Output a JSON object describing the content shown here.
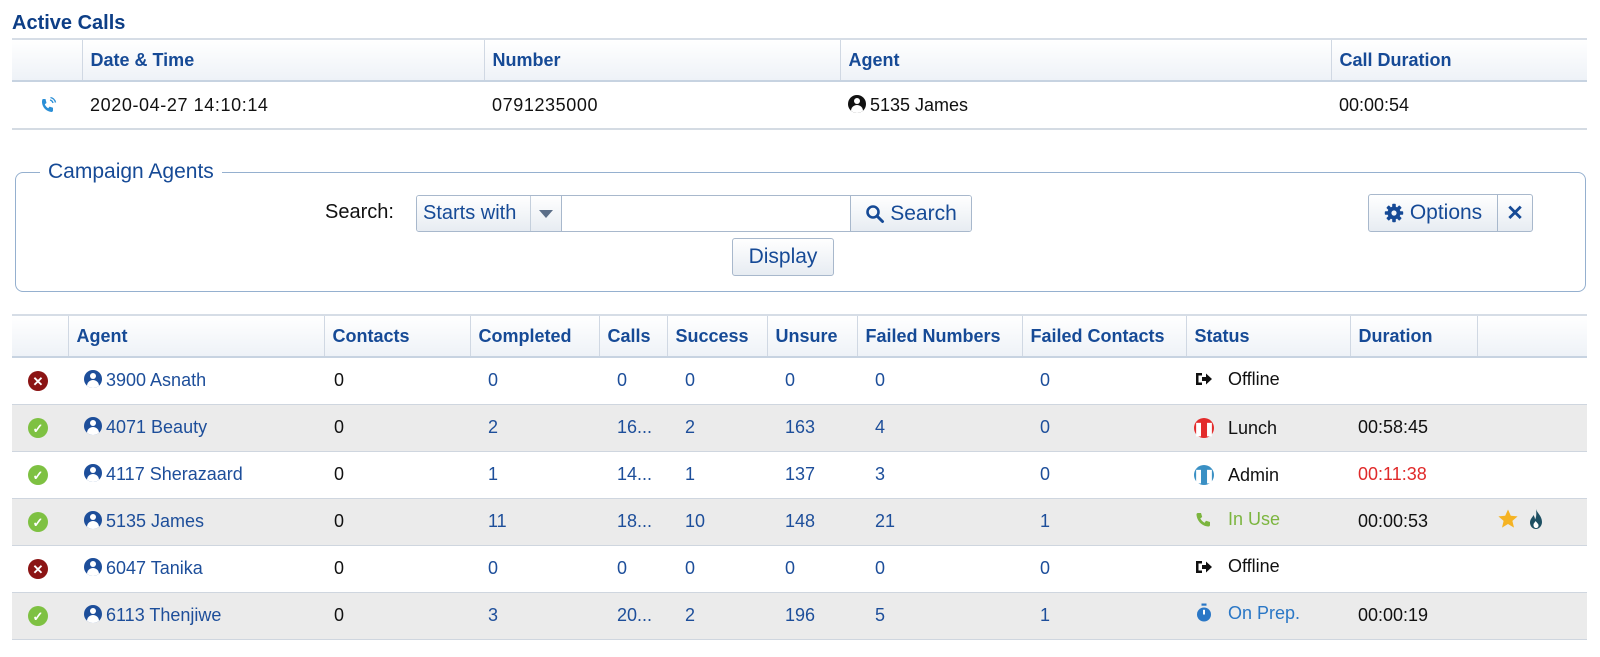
{
  "active_calls": {
    "title": "Active Calls",
    "headers": [
      "",
      "Date & Time",
      "Number",
      "Agent",
      "Call Duration"
    ],
    "rows": [
      {
        "datetime": "2020-04-27 14:10:14",
        "number": "0791235000",
        "agent": "5135 James",
        "duration": "00:00:54"
      }
    ]
  },
  "campaign_agents": {
    "legend": "Campaign Agents",
    "search_label": "Search:",
    "search_mode": "Starts with",
    "search_value": "",
    "search_button": "Search",
    "display_button": "Display",
    "options_button": "Options",
    "close_button": "✕"
  },
  "agents_table": {
    "headers": [
      "",
      "Agent",
      "Contacts",
      "Completed",
      "Calls",
      "Success",
      "Unsure",
      "Failed Numbers",
      "Failed Contacts",
      "Status",
      "Duration",
      ""
    ],
    "rows": [
      {
        "online": false,
        "agent": "3900 Asnath",
        "contacts": "0",
        "completed": "0",
        "calls": "0",
        "success": "0",
        "unsure": "0",
        "failed_numbers": "0",
        "failed_contacts": "0",
        "status": "Offline",
        "status_icon": "sign-out-icon",
        "duration": ""
      },
      {
        "online": true,
        "agent": "4071 Beauty",
        "contacts": "0",
        "completed": "2",
        "calls": "16...",
        "success": "2",
        "unsure": "163",
        "failed_numbers": "4",
        "failed_contacts": "0",
        "status": "Lunch",
        "status_icon": "pause-red-icon",
        "duration": "00:58:45"
      },
      {
        "online": true,
        "agent": "4117 Sherazaard",
        "contacts": "0",
        "completed": "1",
        "calls": "14...",
        "success": "1",
        "unsure": "137",
        "failed_numbers": "3",
        "failed_contacts": "0",
        "status": "Admin",
        "status_icon": "pause-blue-icon",
        "duration": "00:11:38"
      },
      {
        "online": true,
        "agent": "5135 James",
        "contacts": "0",
        "completed": "11",
        "calls": "18...",
        "success": "10",
        "unsure": "148",
        "failed_numbers": "21",
        "failed_contacts": "1",
        "status": "In Use",
        "status_icon": "phone-icon",
        "duration": "00:00:53"
      },
      {
        "online": false,
        "agent": "6047 Tanika",
        "contacts": "0",
        "completed": "0",
        "calls": "0",
        "success": "0",
        "unsure": "0",
        "failed_numbers": "0",
        "failed_contacts": "0",
        "status": "Offline",
        "status_icon": "sign-out-icon",
        "duration": ""
      },
      {
        "online": true,
        "agent": "6113 Thenjiwe",
        "contacts": "0",
        "completed": "3",
        "calls": "20...",
        "success": "2",
        "unsure": "196",
        "failed_numbers": "5",
        "failed_contacts": "1",
        "status": "On Prep.",
        "status_icon": "stopwatch-icon",
        "duration": "00:00:19"
      }
    ]
  },
  "colors": {
    "header_blue": "#164a96",
    "title_blue": "#0d3e86",
    "online_green": "#7ec142",
    "offline_red": "#8b1414",
    "warning_red": "#e02a2a"
  }
}
